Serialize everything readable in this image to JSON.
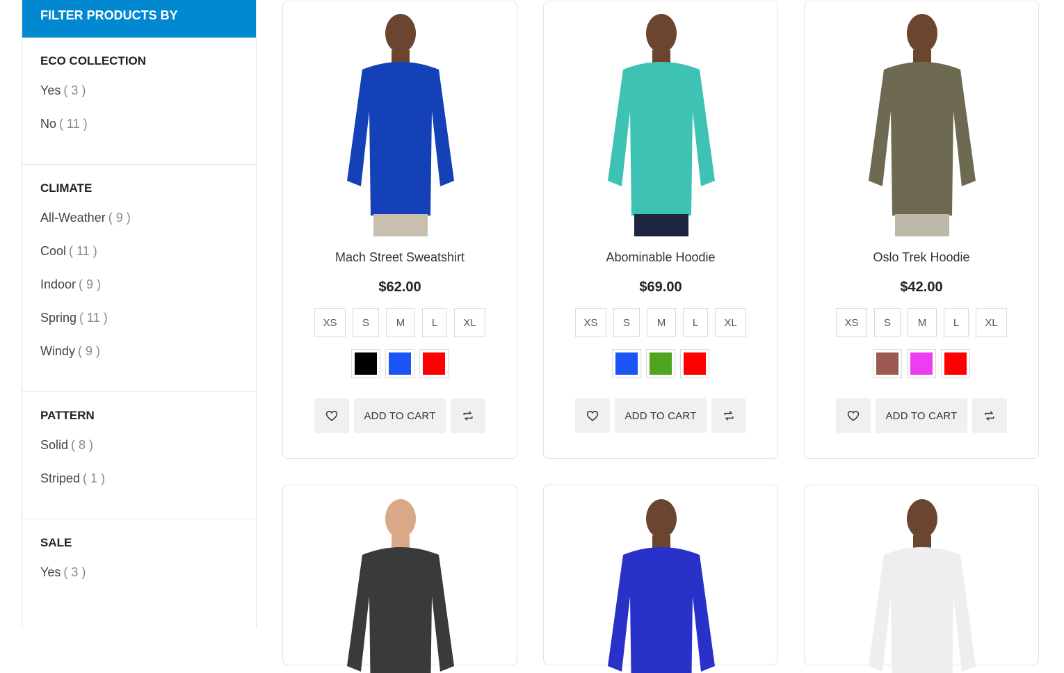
{
  "sidebar": {
    "heading": "FILTER PRODUCTS BY",
    "groups": [
      {
        "title": "ECO COLLECTION",
        "options": [
          {
            "label": "Yes",
            "count": "3"
          },
          {
            "label": "No",
            "count": "11"
          }
        ]
      },
      {
        "title": "CLIMATE",
        "options": [
          {
            "label": "All-Weather",
            "count": "9"
          },
          {
            "label": "Cool",
            "count": "11"
          },
          {
            "label": "Indoor",
            "count": "9"
          },
          {
            "label": "Spring",
            "count": "11"
          },
          {
            "label": "Windy",
            "count": "9"
          }
        ]
      },
      {
        "title": "PATTERN",
        "options": [
          {
            "label": "Solid",
            "count": "8"
          },
          {
            "label": "Striped",
            "count": "1"
          }
        ]
      },
      {
        "title": "SALE",
        "options": [
          {
            "label": "Yes",
            "count": "3"
          }
        ]
      }
    ]
  },
  "products": [
    {
      "name": "Mach Street Sweatshirt",
      "price": "$62.00",
      "sizes": [
        "XS",
        "S",
        "M",
        "L",
        "XL"
      ],
      "swatches": [
        "#000000",
        "#1a56f5",
        "#ff0000"
      ],
      "cart_label": "ADD TO CART",
      "garment": "#1440b8",
      "pants": "#c9bfae",
      "skin": "#6b4530"
    },
    {
      "name": "Abominable Hoodie",
      "price": "$69.00",
      "sizes": [
        "XS",
        "S",
        "M",
        "L",
        "XL"
      ],
      "swatches": [
        "#1a56f5",
        "#4ea520",
        "#ff0000"
      ],
      "cart_label": "ADD TO CART",
      "garment": "#3ec2b3",
      "pants": "#1f2740",
      "skin": "#6b4530"
    },
    {
      "name": "Oslo Trek Hoodie",
      "price": "$42.00",
      "sizes": [
        "XS",
        "S",
        "M",
        "L",
        "XL"
      ],
      "swatches": [
        "#9a5a52",
        "#ee3df0",
        "#ff0000"
      ],
      "cart_label": "ADD TO CART",
      "garment": "#6e6a52",
      "pants": "#bdb8a8",
      "skin": "#6b4530"
    },
    {
      "garment": "#3a3a3a",
      "skin": "#d9a888"
    },
    {
      "garment": "#2a31c9",
      "skin": "#6b4530"
    },
    {
      "garment": "#eeeeee",
      "skin": "#6b4530"
    }
  ]
}
